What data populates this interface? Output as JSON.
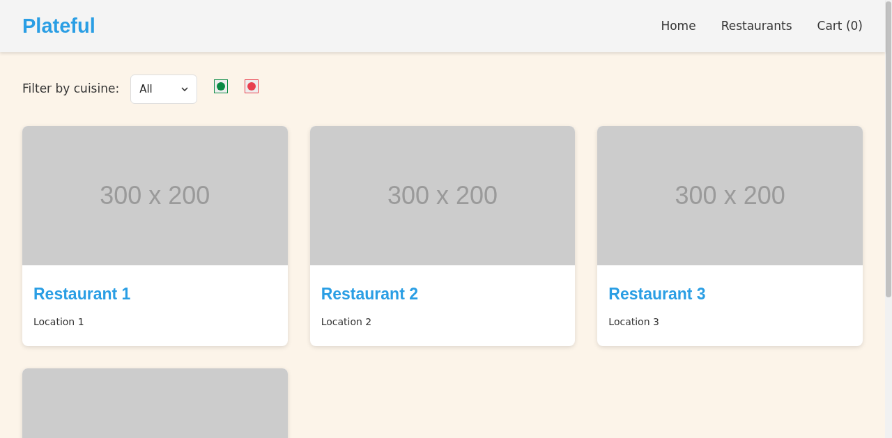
{
  "header": {
    "logo": "Plateful",
    "nav": [
      {
        "label": "Home"
      },
      {
        "label": "Restaurants"
      },
      {
        "label": "Cart (0)"
      }
    ]
  },
  "filter": {
    "label": "Filter by cuisine:",
    "select_value": "All",
    "diet_buttons": [
      {
        "color": "#0a8a44"
      },
      {
        "color": "#e8404f"
      }
    ]
  },
  "restaurants": [
    {
      "kind": "card",
      "image_text": "300 x 200",
      "name": "Restaurant 1",
      "location": "Location 1"
    },
    {
      "kind": "card",
      "image_text": "300 x 200",
      "name": "Restaurant 2",
      "location": "Location 2"
    },
    {
      "kind": "card",
      "image_text": "300 x 200",
      "name": "Restaurant 3",
      "location": "Location 3"
    },
    {
      "kind": "image"
    }
  ]
}
